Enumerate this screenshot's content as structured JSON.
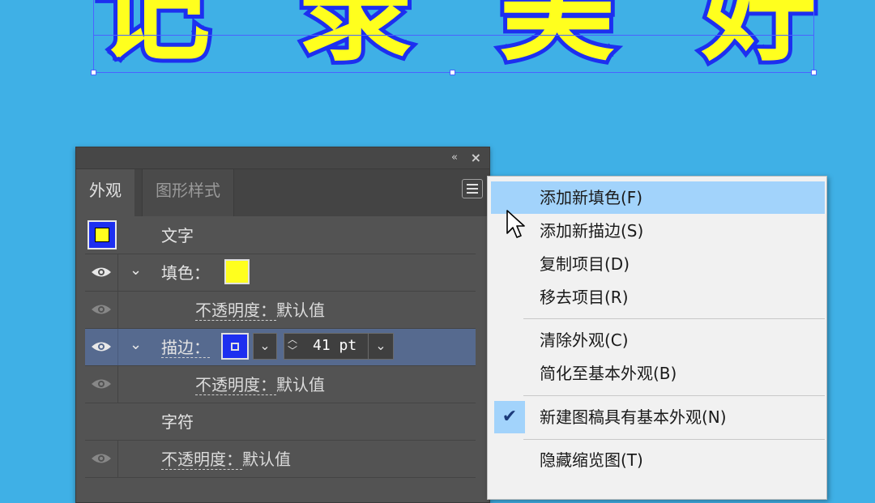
{
  "canvas": {
    "headline_chars": [
      "记",
      "录",
      "美",
      "好"
    ],
    "text_fill_color": "#ffff1e",
    "text_stroke_color": "#1d2ff0",
    "background_color": "#3fb0e6"
  },
  "panel": {
    "collapse_icon": "«",
    "close_icon": "×",
    "tabs": [
      {
        "label": "外观"
      },
      {
        "label": "图形样式"
      }
    ],
    "menu_button_icon": "hamburger-menu-icon",
    "object_label": "文字",
    "fill": {
      "label": "填色：",
      "opacity_label": "不透明度：",
      "opacity_value": "默认值"
    },
    "stroke": {
      "label": "描边：",
      "weight": "41 pt",
      "opacity_label": "不透明度：",
      "opacity_value": "默认值"
    },
    "characters_label": "字符",
    "opacity_label": "不透明度：",
    "opacity_value": "默认值"
  },
  "flyout_menu": {
    "items": [
      {
        "label": "添加新填色(F)"
      },
      {
        "label": "添加新描边(S)"
      },
      {
        "label": "复制项目(D)"
      },
      {
        "label": "移去项目(R)"
      },
      {
        "label": "清除外观(C)"
      },
      {
        "label": "简化至基本外观(B)"
      },
      {
        "label": "新建图稿具有基本外观(N)",
        "checked": true
      },
      {
        "label": "隐藏缩览图(T)"
      }
    ],
    "checkmark": "✔"
  }
}
